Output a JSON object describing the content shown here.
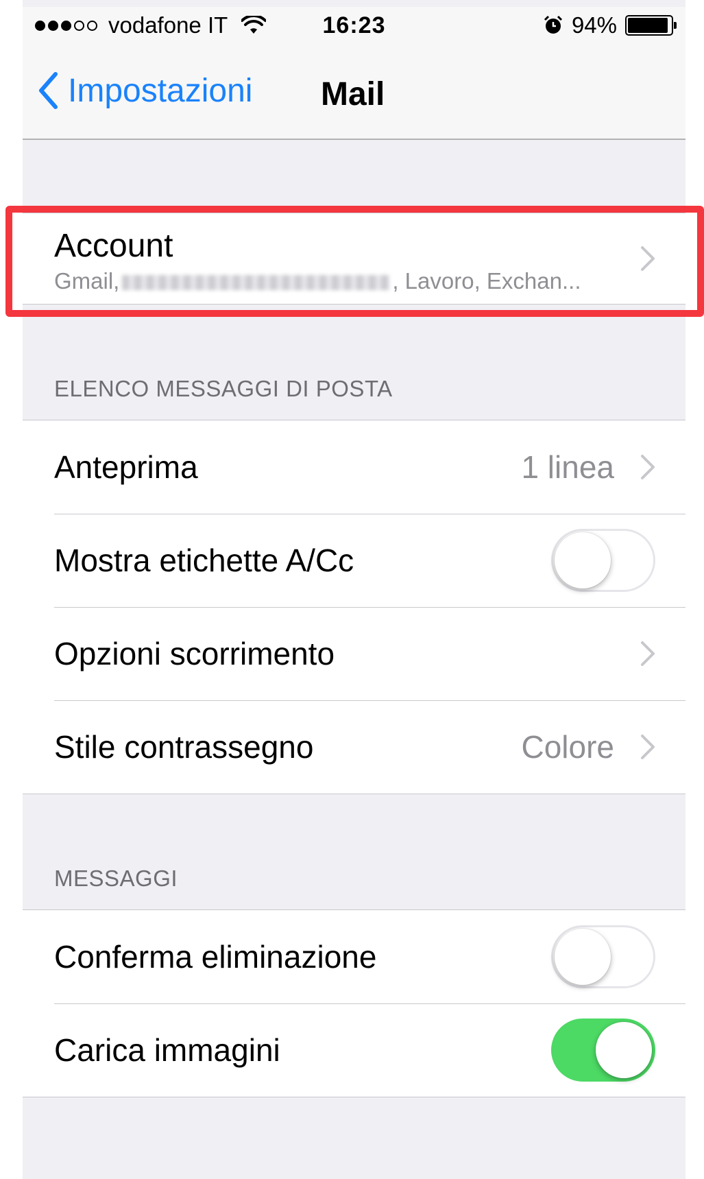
{
  "status_bar": {
    "carrier": "vodafone IT",
    "time": "16:23",
    "battery_percent": "94%",
    "signal_bars_filled": 3,
    "signal_bars_total": 5
  },
  "nav": {
    "back_label": "Impostazioni",
    "title": "Mail"
  },
  "account": {
    "title": "Account",
    "subtitle_start": "Gmail,",
    "subtitle_end": ", Lavoro, Exchan..."
  },
  "sections": {
    "list_header": "ELENCO MESSAGGI DI POSTA",
    "messages_header": "MESSAGGI"
  },
  "list_rows": {
    "preview_label": "Anteprima",
    "preview_value": "1 linea",
    "show_labels_label": "Mostra etichette A/Cc",
    "show_labels_on": false,
    "swipe_options_label": "Opzioni scorrimento",
    "flag_style_label": "Stile contrassegno",
    "flag_style_value": "Colore"
  },
  "message_rows": {
    "confirm_delete_label": "Conferma eliminazione",
    "confirm_delete_on": false,
    "load_images_label": "Carica immagini",
    "load_images_on": true
  },
  "colors": {
    "accent": "#1a82fb",
    "toggle_on": "#4cd964",
    "highlight": "#f4363e",
    "background": "#efeff4"
  }
}
